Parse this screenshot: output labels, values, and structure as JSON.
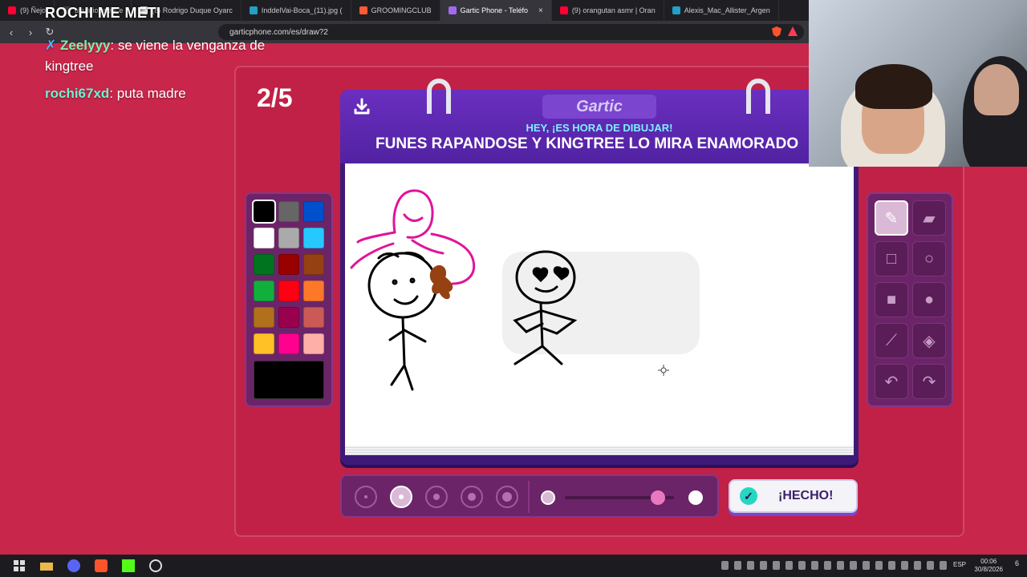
{
  "browser": {
    "tabs": [
      {
        "label": "(9) Ñejo",
        "favicon_color": "#ff0033"
      },
      {
        "label": "usuariojoseo' e",
        "favicon_color": "#444444"
      },
      {
        "label": "(8) Rodrigo Duque Oyarc",
        "favicon_color": "#ffffff"
      },
      {
        "label": "InddelVai-Boca_(11).jpg (",
        "favicon_color": "#21a0c9"
      },
      {
        "label": "GROOMINGCLUB",
        "favicon_color": "#ff5a36"
      },
      {
        "label": "Gartic Phone - Teléfo",
        "favicon_color": "#a368f0",
        "active": true
      },
      {
        "label": "(9) orangutan asmr | Oran",
        "favicon_color": "#ff0033"
      },
      {
        "label": "Alexis_Mac_Allister_Argen",
        "favicon_color": "#21a0c9"
      }
    ],
    "url": "garticphone.com/es/draw?2",
    "back_icon": "‹",
    "forward_icon": "›",
    "reload_icon": "↻",
    "bookmark_icon": "▯",
    "close_icon": "×"
  },
  "stream": {
    "overlay_title": "ROCHI ME METI",
    "chat": [
      {
        "user": "Zeelyyy",
        "user_color": "#7ef0a8",
        "badge": "✗",
        "text": ": se viene la venganza de kingtree"
      },
      {
        "user": "rochi67xd",
        "user_color": "#6ff0d0",
        "badge": "",
        "text": ": puta madre"
      }
    ]
  },
  "game": {
    "round": "2/5",
    "logo": "Gartic",
    "instruction": "HEY, ¡ES HORA DE DIBUJAR!",
    "prompt": "FUNES RAPANDOSE Y KINGTREE LO MIRA ENAMORADO",
    "done_label": "¡HECHO!",
    "palette": [
      "#000000",
      "#666666",
      "#0050cd",
      "#ffffff",
      "#aaaaaa",
      "#26c9ff",
      "#017420",
      "#990000",
      "#964112",
      "#11b03c",
      "#ff0013",
      "#ff7829",
      "#b0701c",
      "#99004e",
      "#cb5a57",
      "#ffc126",
      "#ff008f",
      "#feafa8"
    ],
    "selected_color": "#000000",
    "tools": [
      "pencil-icon",
      "eraser-icon",
      "square-outline-icon",
      "circle-outline-icon",
      "square-filled-icon",
      "circle-filled-icon",
      "line-icon",
      "fill-bucket-icon",
      "undo-icon",
      "redo-icon"
    ],
    "selected_tool": "pencil-icon",
    "brush_sizes": [
      1,
      2,
      3,
      4,
      5
    ],
    "selected_brush_size": 2,
    "opacity_level": 0.85
  },
  "taskbar": {
    "lang": "ESP",
    "time": "00:06",
    "date": "30/8/2026",
    "notifications": "6"
  }
}
